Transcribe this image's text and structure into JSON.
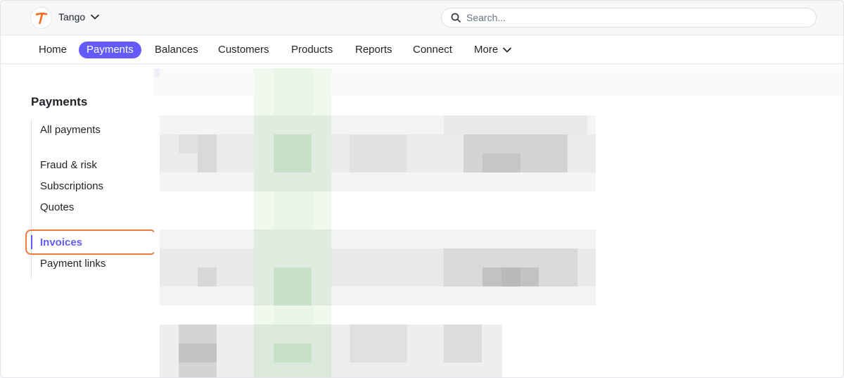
{
  "account": {
    "name": "Tango",
    "logo_letter": "T",
    "brand_color": "#f26b21"
  },
  "search": {
    "placeholder": "Search..."
  },
  "nav": {
    "items": [
      {
        "label": "Home",
        "active": false
      },
      {
        "label": "Payments",
        "active": true
      },
      {
        "label": "Balances",
        "active": false
      },
      {
        "label": "Customers",
        "active": false
      },
      {
        "label": "Products",
        "active": false
      },
      {
        "label": "Reports",
        "active": false
      },
      {
        "label": "Connect",
        "active": false
      }
    ],
    "more_label": "More",
    "accent_color": "#635bff"
  },
  "sidebar": {
    "title": "Payments",
    "items": [
      {
        "label": "All payments",
        "active": false
      },
      {
        "label": "Fraud & risk",
        "active": false
      },
      {
        "label": "Subscriptions",
        "active": false
      },
      {
        "label": "Quotes",
        "active": false
      },
      {
        "label": "Invoices",
        "active": true
      },
      {
        "label": "Payment links",
        "active": false
      }
    ]
  },
  "highlight_color": "#f37a3b"
}
